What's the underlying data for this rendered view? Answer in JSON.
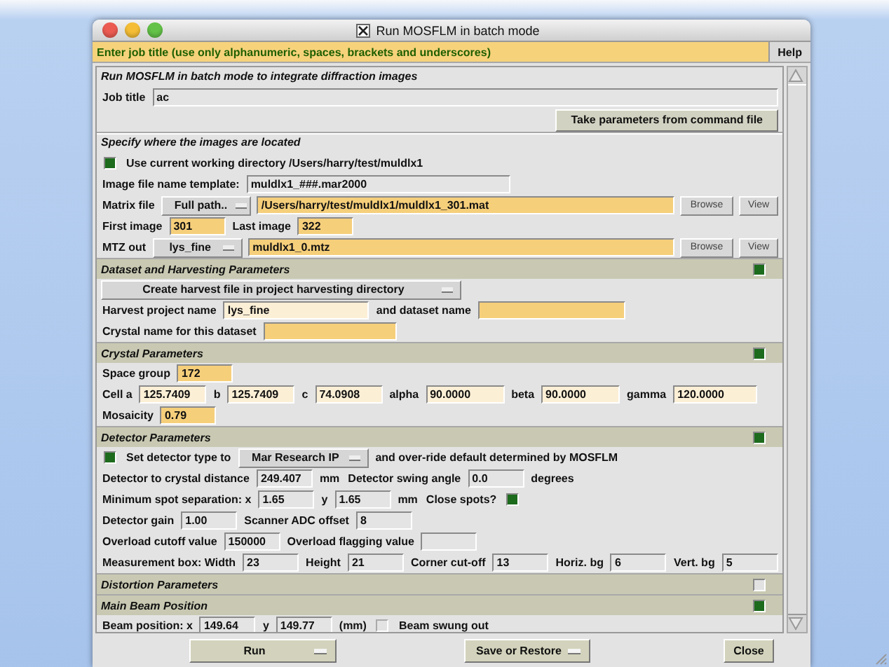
{
  "window": {
    "title": "Run MOSFLM in batch mode"
  },
  "help_bar": {
    "message": "Enter job title (use only alphanumeric, spaces, brackets and underscores)",
    "button": "Help"
  },
  "sections": [
    {
      "kind": "plain",
      "title": "Run MOSFLM in batch mode to integrate diffraction images",
      "rows": [
        {
          "items": [
            {
              "kind": "label",
              "text": "Job title"
            },
            {
              "kind": "field",
              "value": "ac",
              "color": "#e4e4e4"
            }
          ]
        },
        {
          "items": [
            {
              "kind": "button",
              "label": "Take parameters from command file"
            }
          ]
        }
      ]
    },
    {
      "kind": "plain",
      "title": "Specify where the images are located",
      "rows": [
        {
          "items": [
            {
              "kind": "checkbox",
              "checked": true,
              "label": "Use current working directory /Users/harry/test/muldlx1"
            }
          ]
        },
        {
          "items": [
            {
              "kind": "label",
              "text": "Image file name template:"
            },
            {
              "kind": "field",
              "value": "muldlx1_###.mar2000",
              "color": "#e4e4e4"
            }
          ]
        },
        {
          "items": [
            {
              "kind": "label",
              "text": "Matrix file"
            },
            {
              "kind": "dropdown",
              "value": "Full path.."
            },
            {
              "kind": "field",
              "value": "/Users/harry/test/muldlx1/muldlx1_301.mat",
              "color": "#f6cf7b"
            },
            {
              "kind": "button",
              "label": "Browse"
            },
            {
              "kind": "button",
              "label": "View"
            }
          ]
        },
        {
          "items": [
            {
              "kind": "label",
              "text": "First image"
            },
            {
              "kind": "field",
              "value": "301",
              "color": "#f6cf7b"
            },
            {
              "kind": "label",
              "text": "Last image"
            },
            {
              "kind": "field",
              "value": "322",
              "color": "#f6cf7b"
            }
          ]
        },
        {
          "items": [
            {
              "kind": "label",
              "text": "MTZ out"
            },
            {
              "kind": "dropdown",
              "value": "lys_fine"
            },
            {
              "kind": "field",
              "value": "muldlx1_0.mtz",
              "color": "#f6cf7b"
            },
            {
              "kind": "button",
              "label": "Browse"
            },
            {
              "kind": "button",
              "label": "View"
            }
          ]
        }
      ]
    },
    {
      "kind": "toggle",
      "title": "Dataset and Harvesting Parameters",
      "expanded": true,
      "rows": [
        {
          "items": [
            {
              "kind": "dropdown",
              "value": "Create harvest file in project harvesting directory"
            }
          ]
        },
        {
          "items": [
            {
              "kind": "label",
              "text": "Harvest project name"
            },
            {
              "kind": "field",
              "value": "lys_fine",
              "color": "#fbefd6"
            },
            {
              "kind": "label",
              "text": "and dataset name"
            },
            {
              "kind": "field",
              "color": "#f6cf7b"
            }
          ]
        },
        {
          "items": [
            {
              "kind": "label",
              "text": "Crystal name for this dataset"
            },
            {
              "kind": "field",
              "color": "#f6cf7b"
            }
          ]
        }
      ]
    },
    {
      "kind": "toggle",
      "title": "Crystal Parameters",
      "expanded": true,
      "rows": [
        {
          "items": [
            {
              "kind": "label",
              "text": "Space group"
            },
            {
              "kind": "field",
              "value": "172",
              "color": "#f6cf7b"
            }
          ]
        },
        {
          "items": [
            {
              "kind": "label",
              "text": "Cell a"
            },
            {
              "kind": "field",
              "value": "125.7409",
              "color": "#fbefd6"
            },
            {
              "kind": "label",
              "text": "b"
            },
            {
              "kind": "field",
              "value": "125.7409",
              "color": "#fbefd6"
            },
            {
              "kind": "label",
              "text": "c"
            },
            {
              "kind": "field",
              "value": "74.0908",
              "color": "#fbefd6"
            },
            {
              "kind": "label",
              "text": "alpha"
            },
            {
              "kind": "field",
              "value": "90.0000",
              "color": "#fbefd6"
            },
            {
              "kind": "label",
              "text": "beta"
            },
            {
              "kind": "field",
              "value": "90.0000",
              "color": "#fbefd6"
            },
            {
              "kind": "label",
              "text": "gamma"
            },
            {
              "kind": "field",
              "value": "120.0000",
              "color": "#fbefd6"
            }
          ]
        },
        {
          "items": [
            {
              "kind": "label",
              "text": "Mosaicity"
            },
            {
              "kind": "field",
              "value": "0.79",
              "color": "#f6cf7b"
            }
          ]
        }
      ]
    },
    {
      "kind": "toggle",
      "title": "Detector Parameters",
      "expanded": true,
      "rows": [
        {
          "items": [
            {
              "kind": "checkbox",
              "checked": true,
              "label": "Set detector type to"
            },
            {
              "kind": "dropdown",
              "value": "Mar Research IP"
            },
            {
              "kind": "label",
              "text": "and over-ride default determined by MOSFLM"
            }
          ]
        },
        {
          "items": [
            {
              "kind": "label",
              "text": "Detector to crystal distance"
            },
            {
              "kind": "field",
              "value": "249.407",
              "color": "#e4e4e4"
            },
            {
              "kind": "label",
              "text": "mm"
            },
            {
              "kind": "label",
              "text": "Detector swing angle"
            },
            {
              "kind": "field",
              "value": "0.0",
              "color": "#e4e4e4"
            },
            {
              "kind": "label",
              "text": "degrees"
            }
          ]
        },
        {
          "items": [
            {
              "kind": "label",
              "text": "Minimum spot separation: x"
            },
            {
              "kind": "field",
              "value": "1.65",
              "color": "#e4e4e4"
            },
            {
              "kind": "label",
              "text": "y"
            },
            {
              "kind": "field",
              "value": "1.65",
              "color": "#e4e4e4"
            },
            {
              "kind": "label",
              "text": "mm"
            },
            {
              "kind": "label",
              "text": "Close spots?"
            },
            {
              "kind": "checkbox",
              "checked": true
            }
          ]
        },
        {
          "items": [
            {
              "kind": "label",
              "text": "Detector gain"
            },
            {
              "kind": "field",
              "value": "1.00",
              "color": "#e4e4e4"
            },
            {
              "kind": "label",
              "text": "Scanner ADC offset"
            },
            {
              "kind": "field",
              "value": "8",
              "color": "#e4e4e4"
            }
          ]
        },
        {
          "items": [
            {
              "kind": "label",
              "text": "Overload cutoff value"
            },
            {
              "kind": "field",
              "value": "150000",
              "color": "#e4e4e4"
            },
            {
              "kind": "label",
              "text": "Overload flagging value"
            },
            {
              "kind": "field",
              "color": "#e4e4e4"
            }
          ]
        },
        {
          "items": [
            {
              "kind": "label",
              "text": "Measurement box: Width"
            },
            {
              "kind": "field",
              "value": "23",
              "color": "#e4e4e4"
            },
            {
              "kind": "label",
              "text": "Height"
            },
            {
              "kind": "field",
              "value": "21",
              "color": "#e4e4e4"
            },
            {
              "kind": "label",
              "text": "Corner cut-off"
            },
            {
              "kind": "field",
              "value": "13",
              "color": "#e4e4e4"
            },
            {
              "kind": "label",
              "text": "Horiz. bg"
            },
            {
              "kind": "field",
              "value": "6",
              "color": "#e4e4e4"
            },
            {
              "kind": "label",
              "text": "Vert. bg"
            },
            {
              "kind": "field",
              "value": "5",
              "color": "#e4e4e4"
            }
          ]
        }
      ]
    },
    {
      "kind": "toggle",
      "title": "Distortion Parameters",
      "expanded": false
    },
    {
      "kind": "toggle",
      "title": "Main Beam Position",
      "expanded": true,
      "rows": [
        {
          "items": [
            {
              "kind": "label",
              "text": "Beam position: x"
            },
            {
              "kind": "field",
              "value": "149.64",
              "color": "#e4e4e4"
            },
            {
              "kind": "label",
              "text": "y"
            },
            {
              "kind": "field",
              "value": "149.77",
              "color": "#e4e4e4"
            },
            {
              "kind": "label",
              "text": "(mm)"
            },
            {
              "kind": "checkbox",
              "checked": false,
              "label": "Beam swung out"
            }
          ]
        }
      ]
    }
  ],
  "footer_buttons": [
    {
      "label": "Run",
      "menu": true
    },
    {
      "label": "Save or Restore",
      "menu": true
    },
    {
      "label": "Close",
      "menu": false
    }
  ]
}
